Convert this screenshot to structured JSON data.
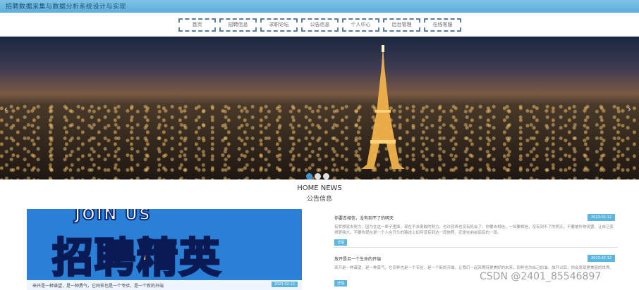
{
  "header": {
    "title": "招聘数据采集与数据分析系统设计与实现"
  },
  "nav": {
    "items": [
      "首页",
      "招聘信息",
      "求职论坛",
      "公告信息",
      "个人中心",
      "后台管理",
      "在线客服"
    ]
  },
  "carousel": {
    "prev": "‹",
    "next": "›",
    "slide_count": 3,
    "active_index": 0
  },
  "section": {
    "title_en": "HOME NEWS",
    "title_cn": "公告信息"
  },
  "featured": {
    "join": "JOIN US",
    "big_text": "招聘精英",
    "caption": "来开是一种谱望，是一种勇气，它同样也是一个专验，是一个新的开端",
    "date": "2023-02-12"
  },
  "news": [
    {
      "title": "你要去相信，没有到不了的明天",
      "date": "2023-02-12",
      "summary": "有梦想就去努力，因为在这一辈子里面，现在不去勇敢的努力，也许就再也没有机会了。你要去相信，一如要相信，没有到不了的明天。不要被外物说罢，让自己变得更强大。不要你现在是一个人在开头的路途上如何没有到达一段旅程，还是在前前后后的一段。",
      "more": "详情"
    },
    {
      "title": "放开是另一个生命的开端",
      "date": "2023-02-12",
      "summary": "来开是一种谱望，是一种勇气，它同样也是一个专验，是一个新的开端，让我们一起来期待更美好的未来，同样也为自己加油。放开以后，你会发现更美丽的世界。",
      "more": "详情"
    }
  ],
  "watermark": "CSDN @2401_85546897",
  "colors": {
    "topbar": "#5aaedb",
    "nav_border": "#5b7fa3",
    "accent": "#5bb7e0",
    "dot_active": "#3b95d4"
  }
}
